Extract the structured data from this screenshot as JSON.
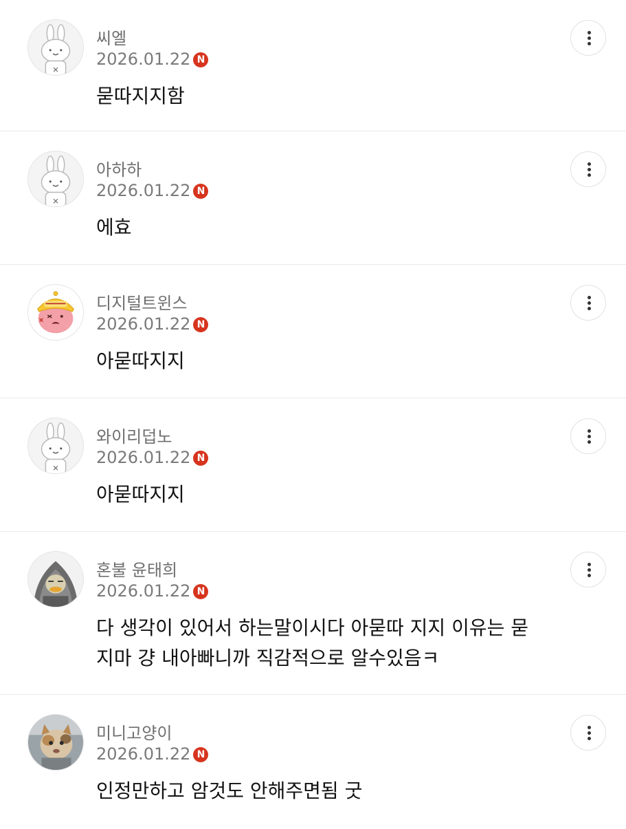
{
  "comments": [
    {
      "nickname": "씨엘",
      "date": "2026.01.22",
      "badge": "N",
      "text": "묻따지지함",
      "avatar": "rabbit-default-icon"
    },
    {
      "nickname": "아하하",
      "date": "2026.01.22",
      "badge": "N",
      "text": "에효",
      "avatar": "rabbit-default-icon"
    },
    {
      "nickname": "디지털트윈스",
      "date": "2026.01.22",
      "badge": "N",
      "text": "아묻따지지",
      "avatar": "pink-character-avatar"
    },
    {
      "nickname": "와이리덥노",
      "date": "2026.01.22",
      "badge": "N",
      "text": "아묻따지지",
      "avatar": "rabbit-default-icon"
    },
    {
      "nickname": "혼불 윤태희",
      "date": "2026.01.22",
      "badge": "N",
      "text": "다 생각이 있어서 하는말이시다 아묻따 지지 이유는 묻지마 걍 내아빠니까 직감적으로 알수있음ㅋ",
      "avatar": "hooded-duck-avatar"
    },
    {
      "nickname": "미니고양이",
      "date": "2026.01.22",
      "badge": "N",
      "text": "인정만하고 암것도 안해주면됨 굿",
      "avatar": "cat-photo-avatar"
    }
  ],
  "colors": {
    "badge": "#d7341e",
    "nickname": "#6f6f6f",
    "divider": "#e9e9e9"
  }
}
